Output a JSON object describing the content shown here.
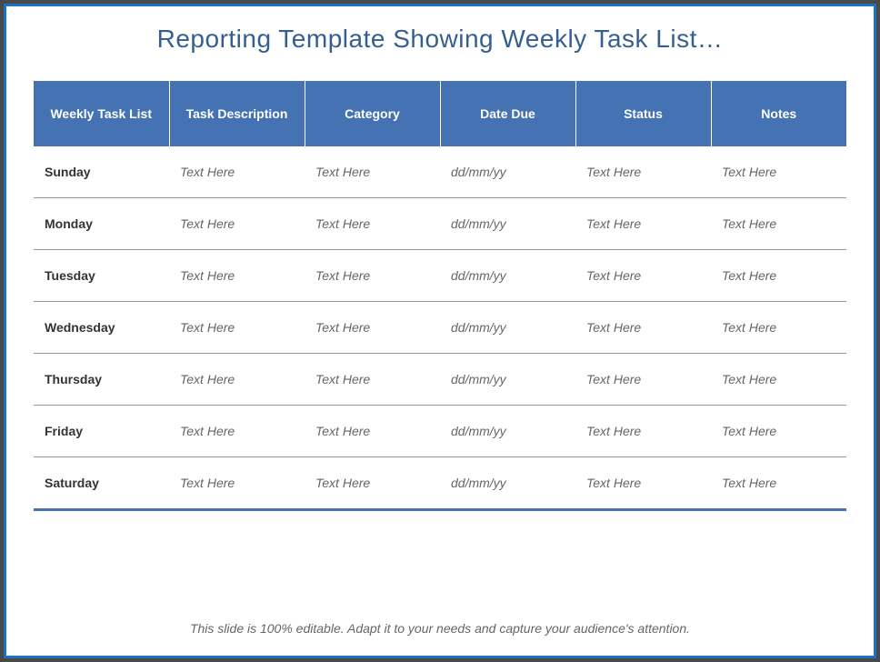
{
  "title": "Reporting Template Showing Weekly Task List…",
  "table": {
    "headers": [
      "Weekly Task List",
      "Task Description",
      "Category",
      "Date Due",
      "Status",
      "Notes"
    ],
    "rows": [
      {
        "day": "Sunday",
        "description": "Text Here",
        "category": "Text Here",
        "date_due": "dd/mm/yy",
        "status": "Text Here",
        "notes": "Text Here"
      },
      {
        "day": "Monday",
        "description": "Text Here",
        "category": "Text Here",
        "date_due": "dd/mm/yy",
        "status": "Text Here",
        "notes": "Text Here"
      },
      {
        "day": "Tuesday",
        "description": "Text Here",
        "category": "Text Here",
        "date_due": "dd/mm/yy",
        "status": "Text Here",
        "notes": "Text Here"
      },
      {
        "day": "Wednesday",
        "description": "Text Here",
        "category": "Text Here",
        "date_due": "dd/mm/yy",
        "status": "Text Here",
        "notes": "Text Here"
      },
      {
        "day": "Thursday",
        "description": "Text Here",
        "category": "Text Here",
        "date_due": "dd/mm/yy",
        "status": "Text Here",
        "notes": "Text Here"
      },
      {
        "day": "Friday",
        "description": "Text Here",
        "category": "Text Here",
        "date_due": "dd/mm/yy",
        "status": "Text Here",
        "notes": "Text Here"
      },
      {
        "day": "Saturday",
        "description": "Text Here",
        "category": "Text Here",
        "date_due": "dd/mm/yy",
        "status": "Text Here",
        "notes": "Text Here"
      }
    ]
  },
  "footer": "This slide is 100% editable. Adapt it to your needs and capture your audience's attention."
}
